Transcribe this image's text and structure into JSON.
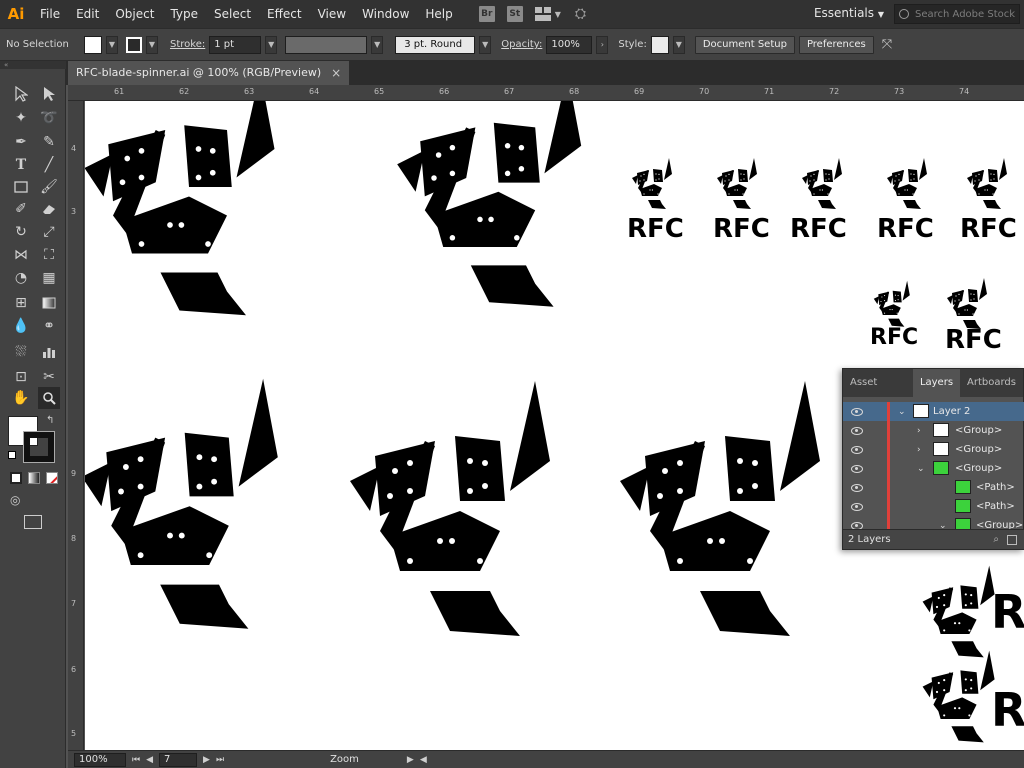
{
  "app": {
    "logo": "Ai",
    "accent": "#ff9a00"
  },
  "menu": [
    "File",
    "Edit",
    "Object",
    "Type",
    "Select",
    "Effect",
    "View",
    "Window",
    "Help"
  ],
  "badges": {
    "bridge": "Br",
    "stock": "St"
  },
  "workspace": {
    "label": "Essentials"
  },
  "search": {
    "placeholder": "Search Adobe Stock"
  },
  "control": {
    "selection": "No Selection",
    "stroke_label": "Stroke:",
    "stroke_value": "1 pt",
    "brush_value": "3 pt. Round",
    "opacity_label": "Opacity:",
    "opacity_value": "100%",
    "style_label": "Style:",
    "document_setup": "Document Setup",
    "preferences": "Preferences"
  },
  "document": {
    "tab_title": "RFC-blade-spinner.ai @ 100% (RGB/Preview)",
    "close": "×"
  },
  "ruler": {
    "top": [
      "61",
      "62",
      "63",
      "64",
      "65",
      "66",
      "67",
      "68",
      "69",
      "70",
      "71",
      "72",
      "73",
      "74"
    ],
    "left": [
      "4",
      "3",
      "9",
      "8",
      "7",
      "6",
      "5"
    ]
  },
  "logo_text": "RFC",
  "status": {
    "zoom": "100%",
    "artboard": "7",
    "mode": "Zoom"
  },
  "layers": {
    "tabs": [
      "Asset Export",
      "Layers",
      "Artboards"
    ],
    "rows": [
      {
        "name": "Layer 2"
      },
      {
        "name": "<Group>"
      },
      {
        "name": "<Group>"
      },
      {
        "name": "<Group>"
      },
      {
        "name": "<Path>"
      },
      {
        "name": "<Path>"
      },
      {
        "name": "<Group>"
      }
    ],
    "count": "2 Layers"
  }
}
